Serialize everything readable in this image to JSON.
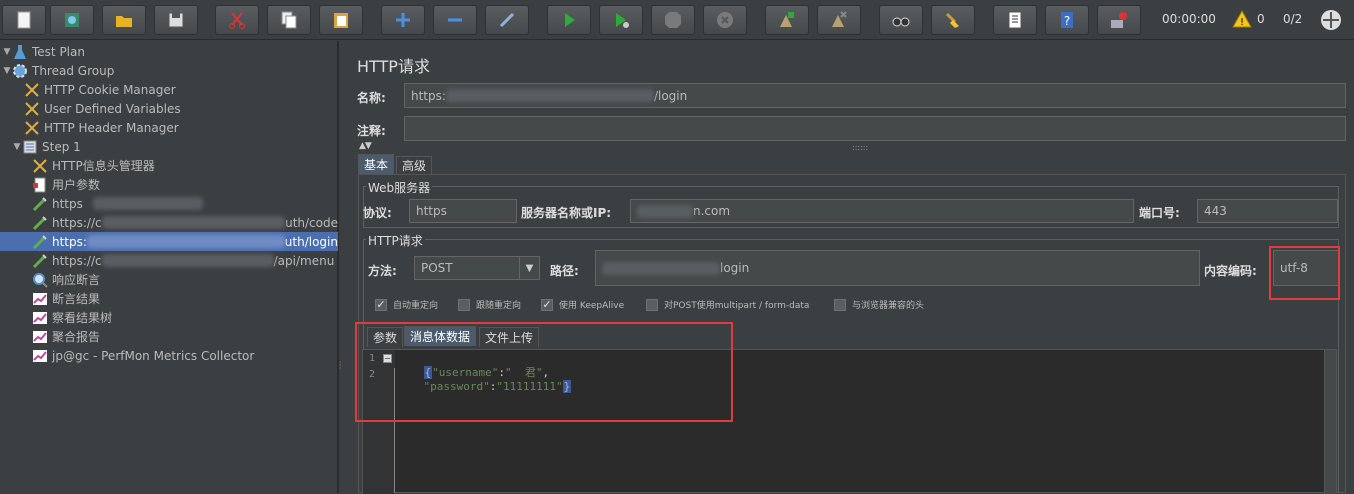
{
  "toolbar": {
    "timer": "00:00:00",
    "warning_count": "0",
    "threads": "0/2",
    "buttons": [
      {
        "name": "new-icon"
      },
      {
        "name": "templates-icon"
      },
      {
        "name": "open-icon"
      },
      {
        "name": "save-icon"
      },
      {
        "name": "cut-icon"
      },
      {
        "name": "copy-icon"
      },
      {
        "name": "paste-icon"
      },
      {
        "name": "expand-icon"
      },
      {
        "name": "collapse-icon"
      },
      {
        "name": "toggle-icon"
      },
      {
        "name": "start-icon"
      },
      {
        "name": "start-no-pause-icon"
      },
      {
        "name": "stop-icon"
      },
      {
        "name": "shutdown-icon"
      },
      {
        "name": "remote-start-icon"
      },
      {
        "name": "remote-stop-icon"
      },
      {
        "name": "search-icon"
      },
      {
        "name": "clear-all-icon"
      },
      {
        "name": "function-helper-icon"
      },
      {
        "name": "help-icon"
      },
      {
        "name": "remote-icon"
      }
    ]
  },
  "tree": {
    "items": [
      {
        "label": "Test Plan"
      },
      {
        "label": "Thread Group"
      },
      {
        "label": "HTTP Cookie Manager"
      },
      {
        "label": "User Defined Variables"
      },
      {
        "label": "HTTP Header Manager"
      },
      {
        "label": "Step 1"
      },
      {
        "label": "HTTP信息头管理器"
      },
      {
        "label": "用户参数"
      },
      {
        "label": "https"
      },
      {
        "label": "https://c",
        "suffix": "uth/code"
      },
      {
        "label": "https:",
        "suffix": "uth/login"
      },
      {
        "label": "https://c",
        "suffix": "/api/menu"
      },
      {
        "label": "响应断言"
      },
      {
        "label": "断言结果"
      },
      {
        "label": "察看结果树"
      },
      {
        "label": "聚合报告"
      },
      {
        "label": "jp@gc - PerfMon Metrics Collector"
      }
    ]
  },
  "panel": {
    "title": "HTTP请求",
    "name_label": "名称:",
    "name_prefix": "https:",
    "name_suffix": "/login",
    "comment_label": "注释:",
    "tabs": [
      "基本",
      "高级"
    ],
    "web_server": {
      "title": "Web服务器",
      "protocol_label": "协议:",
      "protocol_value": "https",
      "server_label": "服务器名称或IP:",
      "server_suffix": "n.com",
      "port_label": "端口号:",
      "port_value": "443"
    },
    "http_request": {
      "title": "HTTP请求",
      "method_label": "方法:",
      "method_value": "POST",
      "path_label": "路径:",
      "path_suffix": "login",
      "encoding_label": "内容编码:",
      "encoding_value": "utf-8"
    },
    "checkboxes": [
      {
        "label": "自动重定向",
        "checked": true
      },
      {
        "label": "跟随重定向",
        "checked": false
      },
      {
        "label": "使用 KeepAlive",
        "checked": true
      },
      {
        "label": "对POST使用multipart / form-data",
        "checked": false
      },
      {
        "label": "与浏览器兼容的头",
        "checked": false
      }
    ],
    "body_tabs": [
      "参数",
      "消息体数据",
      "文件上传"
    ],
    "editor": {
      "lines": [
        "1",
        "2"
      ],
      "line1_key": "\"username\"",
      "line1_colon": ":",
      "line1_value": "\"  君\"",
      "line1_comma": ",",
      "line2_key": "\"password\"",
      "line2_colon": ":",
      "line2_value": "\"11111111\""
    }
  }
}
